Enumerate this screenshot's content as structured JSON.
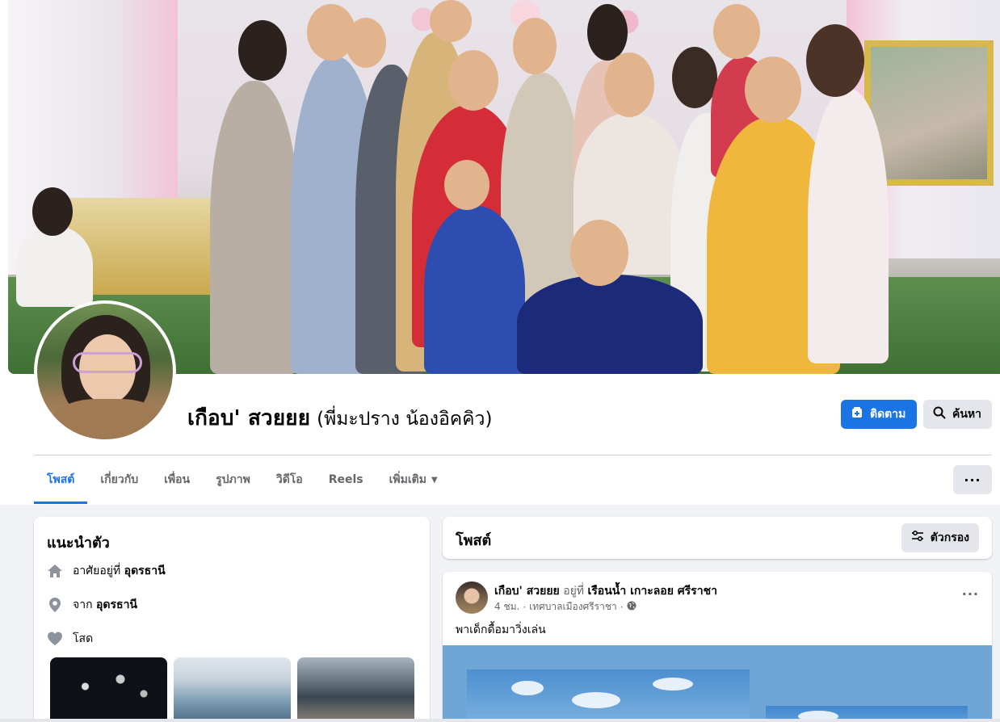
{
  "profile": {
    "name": "เกือบ' สวยยย",
    "alt_name": "(พี่มะปราง น้องอิคคิว)",
    "follow_label": "ติดตาม",
    "search_label": "ค้นหา"
  },
  "tabs": [
    {
      "label": "โพสต์",
      "active": true
    },
    {
      "label": "เกี่ยวกับ"
    },
    {
      "label": "เพื่อน"
    },
    {
      "label": "รูปภาพ"
    },
    {
      "label": "วิดีโอ"
    },
    {
      "label": "Reels"
    },
    {
      "label": "เพิ่มเติม"
    }
  ],
  "more_label": "···",
  "intro": {
    "title": "แนะนำตัว",
    "lives_prefix": "อาศัยอยู่ที่",
    "lives_place": "อุดรธานี",
    "from_prefix": "จาก",
    "from_place": "อุดรธานี",
    "relationship": "โสด"
  },
  "posts_header": {
    "title": "โพสต์",
    "filter_label": "ตัวกรอง"
  },
  "post": {
    "author": "เกือบ' สวยยย",
    "at_word": "อยู่ที่",
    "location": "เรือนน้ำ เกาะลอย ศรีราชา",
    "time": "4 ชม.",
    "place_meta": "เทศบาลเมืองศรีราชา",
    "text": "พาเด็กดื้อมาวิ่งเล่น",
    "menu": "···"
  },
  "icons": {
    "follow": "add-friend-icon",
    "search": "search-icon",
    "home": "home-icon",
    "pin": "location-pin-icon",
    "heart": "heart-icon",
    "filter": "filter-icon",
    "globe": "globe-icon"
  },
  "colors": {
    "accent": "#1b74e4",
    "page_bg": "#f0f2f5",
    "secondary_text": "#65676b",
    "button_grey": "#e4e6eb"
  }
}
